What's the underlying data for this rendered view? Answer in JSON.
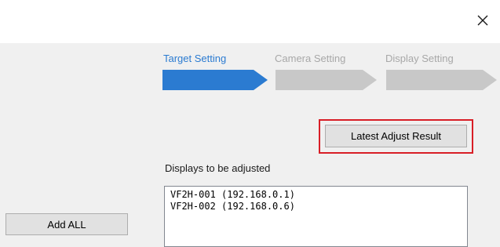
{
  "window": {
    "close_symbol": "✕"
  },
  "steps": [
    {
      "label": "Target Setting",
      "state": "active",
      "color": "#2b7bd1"
    },
    {
      "label": "Camera Setting",
      "state": "inactive",
      "color": "#c8c8c8"
    },
    {
      "label": "Display Setting",
      "state": "inactive",
      "color": "#c8c8c8"
    }
  ],
  "buttons": {
    "latest_adjust_result": "Latest Adjust Result",
    "add_all": "Add ALL"
  },
  "highlight_color": "#d81e26",
  "displays": {
    "label": "Displays to be adjusted",
    "items": [
      "VF2H-001 (192.168.0.1)",
      "VF2H-002 (192.168.0.6)"
    ]
  }
}
